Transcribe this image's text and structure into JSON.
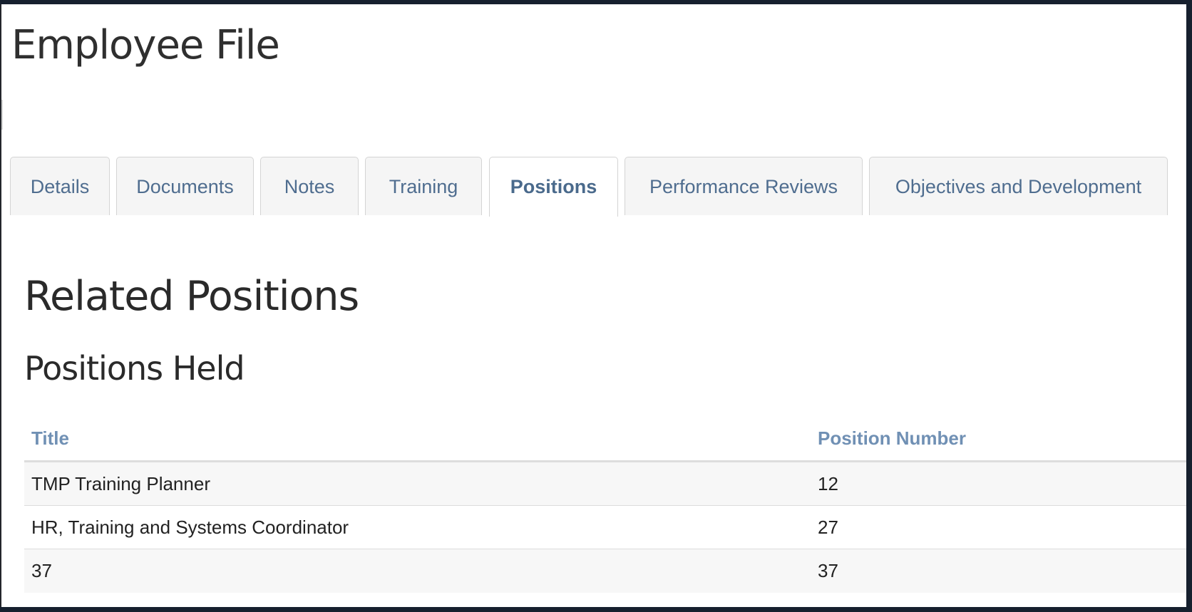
{
  "page": {
    "title": "Employee File"
  },
  "tabs": [
    {
      "label": "Details",
      "active": false
    },
    {
      "label": "Documents",
      "active": false
    },
    {
      "label": "Notes",
      "active": false
    },
    {
      "label": "Training",
      "active": false
    },
    {
      "label": "Positions",
      "active": true
    },
    {
      "label": "Performance Reviews",
      "active": false
    },
    {
      "label": "Objectives and Development",
      "active": false
    }
  ],
  "section": {
    "title": "Related Positions",
    "subtitle": "Positions Held"
  },
  "table": {
    "columns": [
      "Title",
      "Position Number"
    ],
    "rows": [
      {
        "title": "TMP Training Planner",
        "number": "12"
      },
      {
        "title": "HR, Training and Systems Coordinator",
        "number": "27"
      },
      {
        "title": "37",
        "number": "37"
      }
    ]
  },
  "colors": {
    "tab_text": "#4f6d8f",
    "header_link": "#7090b4",
    "background_frame": "#16202e"
  }
}
